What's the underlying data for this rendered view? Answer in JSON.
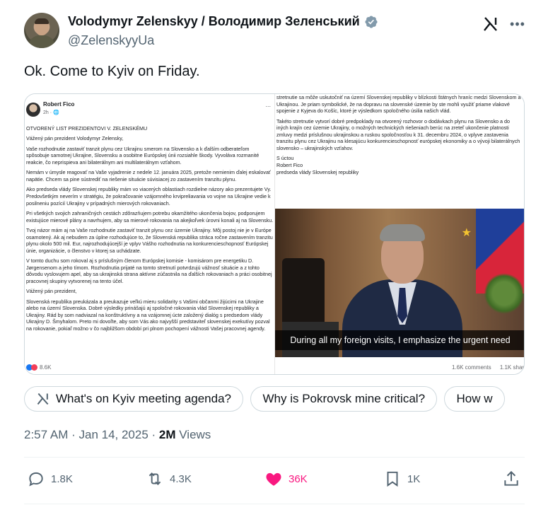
{
  "author": {
    "display_name": "Volodymyr Zelenskyy / Володимир Зеленський",
    "handle": "@ZelenskyyUa",
    "verified": true
  },
  "tweet": {
    "text": "Ok. Come to Kyiv on Friday."
  },
  "media": {
    "fb_post": {
      "author": "Robert Fico",
      "time": "2h",
      "more": "...",
      "left_paragraphs": [
        "OTVORENÝ LIST PREZIDENTOVI V. ZELENSKÉMU",
        "Vážený pán prezident Volodymyr Zelensky,",
        "Vaše rozhodnutie zastaviť tranzit plynu cez Ukrajinu smerom na Slovensko a k ďalším odberateľom spôsobuje samotnej Ukrajine, Slovensku a osobitne Európskej únii rozsiahle škody. Vyvoláva rozmanité reakcie, čo neprispieva ani bilaterálnym ani multilaterálnym vzťahom.",
        "Nemám v úmysle reagovať na Vaše vyjadrenie z nedele 12. januára 2025, pretože nemienim ďalej eskalovať napätie. Chcem sa pine sústrediť na riešenie situácie súvisiacej zo zastavením tranzitu plynu.",
        "Ako predseda vlády Slovenskej republiky mám vo viacerých oblastiach rozdielne názory ako prezentujete Vy. Predovšetkým neverím v stratégiu, že pokračovanie vzájomného krvipreliavania vo vojne na Ukrajine vedie k posilneniu pozícií Ukrajiny v prípadných mierových rokovaniach.",
        "Pri všetkých svojich zahraničných cestách zdôrazňujem potrebu okamžitého ukončenia bojov, podporujem existujúce mierové plány a navrhujem, aby sa mierové rokovania na akejkoľvek úrovni konali aj na Slovensku.",
        "Tvoj názor mám aj na Vaše rozhodnutie zastaviť tranzit plynu cez územie Ukrajiny. Môj postoj nie je v Európe osamotený. Ak aj nebudem za úplne rozhodujúce to, že Slovenská republika stráca ročne zastavením tranzitu plynu okolo 500 mil. Eur, najrozhodujúcejší je vplyv Vášho rozhodnutia na konkurencieschopnosť Európskej únie, organizácie, o členstvo v ktorej sa uchádzate.",
        "V tomto duchu som rokoval aj s príslušným členom Európskej komisie - komisárom pre energetiku D. Jørgensenom a jeho tímom. Rozhodnutia prijaté na tomto stretnutí potvrdzujú vážnosť situácie a z tohto dôvodu vyslovujem apel, aby sa ukrajinská strana aktívne zúčastnila na ďalších rokovaniach a práci osobitnej pracovnej skupiny vytvorenej na tento účel.",
        "Vážený pán prezident,",
        "Slovenská republika preukázala a preukazuje veľkú mieru solidarity s Vašimi občanmi žijúcimi na Ukrajine alebo na území Slovenska. Dobré výsledky prinášajú aj spoločné rokovania vlád Slovenskej republiky a Ukrajiny. Rád by som nadviazal na konštruktívny a na vzájomnej úcte založený dialóg s predsedom vlády Ukrajiny D. Šmyhalom. Preto mi dovoľte, aby som Vás ako najvyšší predstaviteľ slovenskej exekutívy pozval na rokovanie, pokiaľ možno v čo najbližšom období pri plnom pochopení vážnosti Vašej pracovnej agendy."
      ],
      "right_paragraphs": [
        "stretnutie sa môže uskutočniť na území Slovenskej republiky v blízkosti štátnych hraníc medzi Slovenskom a Ukrajinou. Je priam symbolické, že na dopravu na slovenské územie by ste mohli využiť priame vlakové spojenie z Kyjeva do Košíc, ktoré je výsledkom spoločného úsilia našich vlád.",
        "Takéto stretnutie vytvorí dobré predpoklady na otvorený rozhovor o dodávkach plynu na Slovensko a do iných krajín cez územie Ukrajiny, o možných technických riešeniach berúc na zreteľ ukončenie platnosti zmluvy medzi príslušnou ukrajinskou a ruskou spoločnosťou k 31. decembru 2024, o vplyve zastavenia tranzitu plynu cez Ukrajinu na klesajúcu konkurencieschopnosť európskej ekonomiky a o vývoji bilaterálnych slovensko – ukrajinských vzťahov.",
        "S úctou\nRobert Fico\npredseda vlády Slovenskej republiky"
      ],
      "caption": "During all my foreign visits, I emphasize the urgent need",
      "reactions_count": "8.6K",
      "comments": "1.6K comments",
      "shares": "1.1K shar"
    }
  },
  "chips": [
    {
      "label": "What's on Kyiv meeting agenda?"
    },
    {
      "label": "Why is Pokrovsk mine critical?"
    },
    {
      "label": "How w"
    }
  ],
  "meta": {
    "time": "2:57 AM",
    "sep1": " · ",
    "date": "Jan 14, 2025",
    "sep2": " · ",
    "views_count": "2M",
    "views_label": " Views"
  },
  "actions": {
    "replies": "1.8K",
    "reposts": "4.3K",
    "likes": "36K",
    "bookmarks": "1K"
  },
  "colors": {
    "accent": "#1d9bf0",
    "like": "#f91880",
    "verified": "#829aab",
    "text_secondary": "#536471"
  }
}
